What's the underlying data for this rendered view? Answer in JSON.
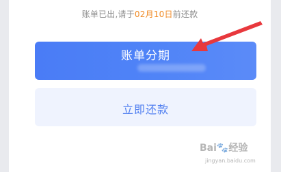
{
  "notice": {
    "prefix": "账单已出,请于",
    "date": "02月10日",
    "suffix": "前还款"
  },
  "buttons": {
    "installment_label": "账单分期",
    "repay_label": "立即还款"
  },
  "colors": {
    "primary": "#4f83f7",
    "secondary_bg": "#eff3fe",
    "secondary_text": "#4f7ef0",
    "date_highlight": "#f08a24",
    "arrow": "#e8383d"
  },
  "watermark": {
    "brand": "Bai🐾经验",
    "url": "jingyan.baidu.com"
  }
}
